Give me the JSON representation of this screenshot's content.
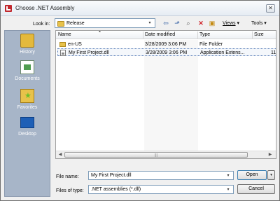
{
  "window": {
    "title": "Choose .NET Assembly",
    "close_glyph": "✕"
  },
  "toolbar": {
    "look_in_label": "Look in:",
    "look_in_value": "Release",
    "views_label": "Views",
    "tools_label": "Tools",
    "dropdown_glyph": "▾"
  },
  "places": [
    {
      "label": "History",
      "icon": "history-folder-icon"
    },
    {
      "label": "Documents",
      "icon": "documents-icon"
    },
    {
      "label": "Favorites",
      "icon": "favorites-icon"
    },
    {
      "label": "Desktop",
      "icon": "desktop-icon"
    }
  ],
  "file_list": {
    "columns": [
      "Name",
      "Date modified",
      "Type",
      "Size"
    ],
    "rows": [
      {
        "name": "en-US",
        "date": "3/28/2009 3:06 PM",
        "type": "File Folder",
        "size": "",
        "icon": "folder-icon"
      },
      {
        "name": "My First Project.dll",
        "date": "3/28/2009 3:06 PM",
        "type": "Application Extens...",
        "size": "11",
        "icon": "dll-file-icon"
      }
    ]
  },
  "footer": {
    "file_name_label": "File name:",
    "file_name_value": "My First Project.dll",
    "files_of_type_label": "Files of type:",
    "files_of_type_value": ".NET assemblies (*.dll)",
    "open_label": "Open",
    "cancel_label": "Cancel"
  },
  "colors": {
    "places_bar": "#a7b5c8",
    "selection_border": "#5a7fb8",
    "delete_icon": "#d0262c"
  }
}
